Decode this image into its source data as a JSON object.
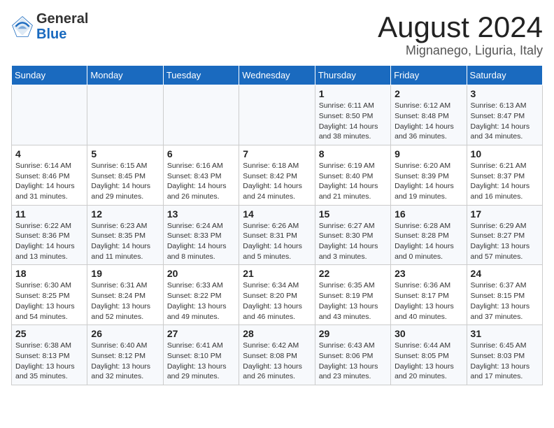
{
  "header": {
    "logo_general": "General",
    "logo_blue": "Blue",
    "month_title": "August 2024",
    "location": "Mignanego, Liguria, Italy"
  },
  "calendar": {
    "days_of_week": [
      "Sunday",
      "Monday",
      "Tuesday",
      "Wednesday",
      "Thursday",
      "Friday",
      "Saturday"
    ],
    "weeks": [
      [
        {
          "day": "",
          "info": ""
        },
        {
          "day": "",
          "info": ""
        },
        {
          "day": "",
          "info": ""
        },
        {
          "day": "",
          "info": ""
        },
        {
          "day": "1",
          "info": "Sunrise: 6:11 AM\nSunset: 8:50 PM\nDaylight: 14 hours and 38 minutes."
        },
        {
          "day": "2",
          "info": "Sunrise: 6:12 AM\nSunset: 8:48 PM\nDaylight: 14 hours and 36 minutes."
        },
        {
          "day": "3",
          "info": "Sunrise: 6:13 AM\nSunset: 8:47 PM\nDaylight: 14 hours and 34 minutes."
        }
      ],
      [
        {
          "day": "4",
          "info": "Sunrise: 6:14 AM\nSunset: 8:46 PM\nDaylight: 14 hours and 31 minutes."
        },
        {
          "day": "5",
          "info": "Sunrise: 6:15 AM\nSunset: 8:45 PM\nDaylight: 14 hours and 29 minutes."
        },
        {
          "day": "6",
          "info": "Sunrise: 6:16 AM\nSunset: 8:43 PM\nDaylight: 14 hours and 26 minutes."
        },
        {
          "day": "7",
          "info": "Sunrise: 6:18 AM\nSunset: 8:42 PM\nDaylight: 14 hours and 24 minutes."
        },
        {
          "day": "8",
          "info": "Sunrise: 6:19 AM\nSunset: 8:40 PM\nDaylight: 14 hours and 21 minutes."
        },
        {
          "day": "9",
          "info": "Sunrise: 6:20 AM\nSunset: 8:39 PM\nDaylight: 14 hours and 19 minutes."
        },
        {
          "day": "10",
          "info": "Sunrise: 6:21 AM\nSunset: 8:37 PM\nDaylight: 14 hours and 16 minutes."
        }
      ],
      [
        {
          "day": "11",
          "info": "Sunrise: 6:22 AM\nSunset: 8:36 PM\nDaylight: 14 hours and 13 minutes."
        },
        {
          "day": "12",
          "info": "Sunrise: 6:23 AM\nSunset: 8:35 PM\nDaylight: 14 hours and 11 minutes."
        },
        {
          "day": "13",
          "info": "Sunrise: 6:24 AM\nSunset: 8:33 PM\nDaylight: 14 hours and 8 minutes."
        },
        {
          "day": "14",
          "info": "Sunrise: 6:26 AM\nSunset: 8:31 PM\nDaylight: 14 hours and 5 minutes."
        },
        {
          "day": "15",
          "info": "Sunrise: 6:27 AM\nSunset: 8:30 PM\nDaylight: 14 hours and 3 minutes."
        },
        {
          "day": "16",
          "info": "Sunrise: 6:28 AM\nSunset: 8:28 PM\nDaylight: 14 hours and 0 minutes."
        },
        {
          "day": "17",
          "info": "Sunrise: 6:29 AM\nSunset: 8:27 PM\nDaylight: 13 hours and 57 minutes."
        }
      ],
      [
        {
          "day": "18",
          "info": "Sunrise: 6:30 AM\nSunset: 8:25 PM\nDaylight: 13 hours and 54 minutes."
        },
        {
          "day": "19",
          "info": "Sunrise: 6:31 AM\nSunset: 8:24 PM\nDaylight: 13 hours and 52 minutes."
        },
        {
          "day": "20",
          "info": "Sunrise: 6:33 AM\nSunset: 8:22 PM\nDaylight: 13 hours and 49 minutes."
        },
        {
          "day": "21",
          "info": "Sunrise: 6:34 AM\nSunset: 8:20 PM\nDaylight: 13 hours and 46 minutes."
        },
        {
          "day": "22",
          "info": "Sunrise: 6:35 AM\nSunset: 8:19 PM\nDaylight: 13 hours and 43 minutes."
        },
        {
          "day": "23",
          "info": "Sunrise: 6:36 AM\nSunset: 8:17 PM\nDaylight: 13 hours and 40 minutes."
        },
        {
          "day": "24",
          "info": "Sunrise: 6:37 AM\nSunset: 8:15 PM\nDaylight: 13 hours and 37 minutes."
        }
      ],
      [
        {
          "day": "25",
          "info": "Sunrise: 6:38 AM\nSunset: 8:13 PM\nDaylight: 13 hours and 35 minutes."
        },
        {
          "day": "26",
          "info": "Sunrise: 6:40 AM\nSunset: 8:12 PM\nDaylight: 13 hours and 32 minutes."
        },
        {
          "day": "27",
          "info": "Sunrise: 6:41 AM\nSunset: 8:10 PM\nDaylight: 13 hours and 29 minutes."
        },
        {
          "day": "28",
          "info": "Sunrise: 6:42 AM\nSunset: 8:08 PM\nDaylight: 13 hours and 26 minutes."
        },
        {
          "day": "29",
          "info": "Sunrise: 6:43 AM\nSunset: 8:06 PM\nDaylight: 13 hours and 23 minutes."
        },
        {
          "day": "30",
          "info": "Sunrise: 6:44 AM\nSunset: 8:05 PM\nDaylight: 13 hours and 20 minutes."
        },
        {
          "day": "31",
          "info": "Sunrise: 6:45 AM\nSunset: 8:03 PM\nDaylight: 13 hours and 17 minutes."
        }
      ]
    ]
  }
}
